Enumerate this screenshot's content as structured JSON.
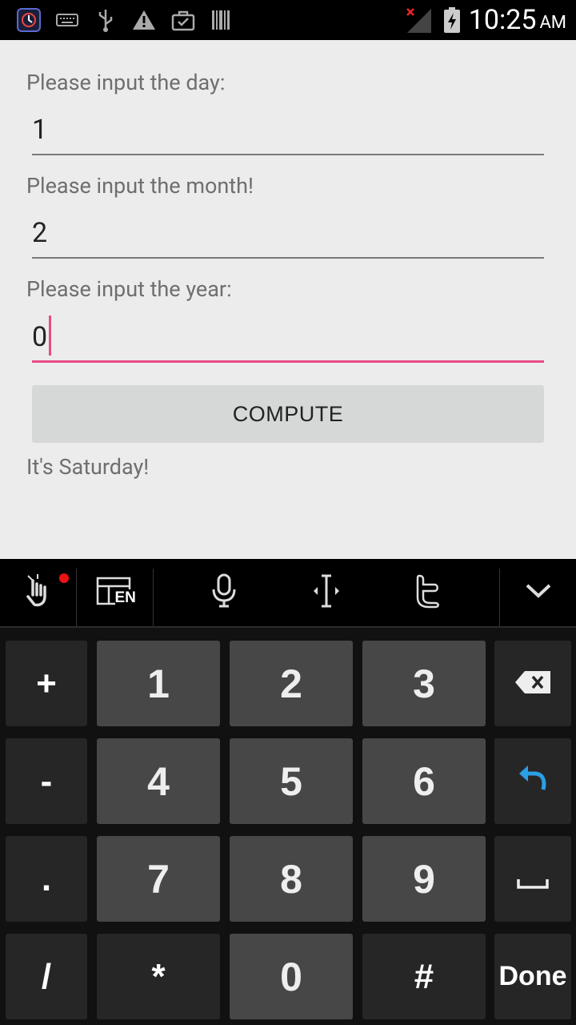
{
  "status_bar": {
    "time": "10:25",
    "ampm": "AM",
    "left_icons": [
      "app-icon",
      "keyboard-icon",
      "usb-icon",
      "warning-icon",
      "briefcase-icon",
      "barcode-icon"
    ],
    "right_icons": [
      "no-signal-icon",
      "battery-charging-icon"
    ]
  },
  "form": {
    "day_label": "Please input the day:",
    "day_value": "1",
    "month_label": "Please input the month!",
    "month_value": "2",
    "year_label": "Please input the year:",
    "year_value": "0",
    "compute_label": "COMPUTE",
    "result_text": "It's Saturday!"
  },
  "keyboard": {
    "toolbar": {
      "language": "EN",
      "icons": [
        "gesture-icon",
        "layout-language-icon",
        "microphone-icon",
        "cursor-move-icon",
        "twitter-icon",
        "hide-keyboard-icon"
      ]
    },
    "rows": [
      [
        "+",
        "1",
        "2",
        "3",
        "backspace"
      ],
      [
        "-",
        "4",
        "5",
        "6",
        "enter"
      ],
      [
        ".",
        "7",
        "8",
        "9",
        "space"
      ],
      [
        "/",
        "*",
        "0",
        "#",
        "Done"
      ]
    ],
    "accent_color": "#e84c85",
    "enter_color": "#2b9fe6"
  }
}
